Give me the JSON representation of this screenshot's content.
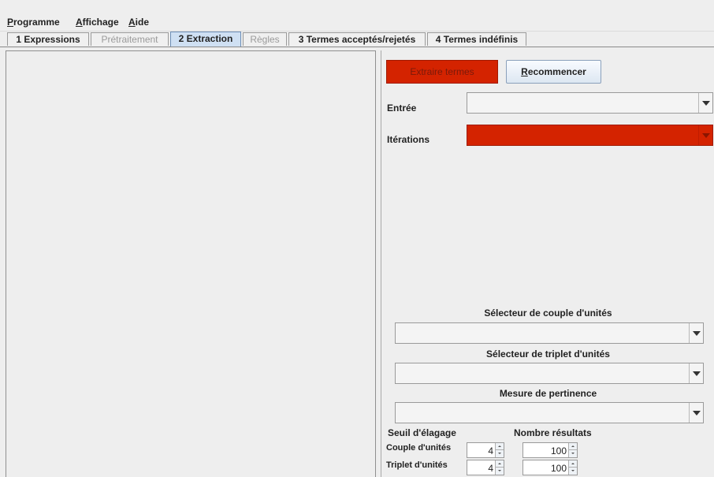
{
  "menu": {
    "programme": {
      "mnemonic": "P",
      "rest": "rogramme"
    },
    "affichage": {
      "mnemonic": "A",
      "rest": "ffichage"
    },
    "aide": {
      "mnemonic": "A",
      "rest": "ide"
    }
  },
  "tabs": [
    {
      "label": "1 Expressions"
    },
    {
      "label": "Prétraitement"
    },
    {
      "label": "2 Extraction"
    },
    {
      "label": "Règles"
    },
    {
      "label": "3 Termes acceptés/rejetés"
    },
    {
      "label": "4 Termes indéfinis"
    }
  ],
  "buttons": {
    "extract": "Extraire termes",
    "restart": {
      "mnemonic": "R",
      "rest": "ecommencer"
    }
  },
  "labels": {
    "entree": "Entrée",
    "iterations": "Itérations",
    "couple_selector": "Sélecteur de couple d'unités",
    "triplet_selector": "Sélecteur de triplet d'unités",
    "pertinence": "Mesure de pertinence",
    "seuil": "Seuil d'élagage",
    "nombre": "Nombre résultats",
    "couple": "Couple d'unités",
    "triplet": "Triplet d'unités"
  },
  "spinners": {
    "seuil_couple": "4",
    "seuil_triplet": "4",
    "nombre_couple": "100",
    "nombre_triplet": "100"
  },
  "colors": {
    "error_red": "#d42300",
    "selected_tab": "#cfe0f3"
  }
}
